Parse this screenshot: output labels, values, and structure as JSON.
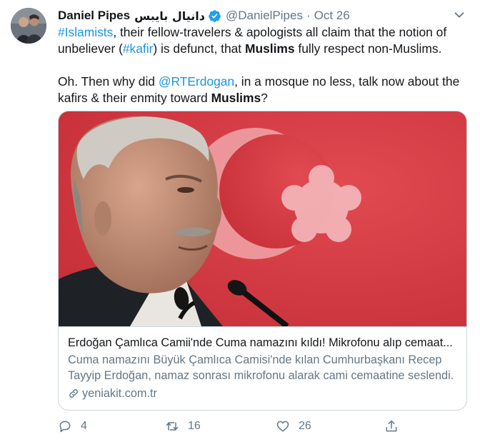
{
  "tweet": {
    "author": {
      "name": "Daniel Pipes",
      "name_arabic": "دانيال بايبس",
      "handle": "@DanielPipes",
      "separator": "·",
      "date": "Oct 26"
    },
    "text": {
      "p1": {
        "hashtag1": "#Islamists",
        "seg1": ", their fellow-travelers & apologists all claim that the notion of unbeliever (",
        "hashtag2": "#kafir",
        "seg2": ") is defunct, that ",
        "bold1": "Muslims",
        "seg3": " fully respect non-Muslims."
      },
      "p2": {
        "seg1": "Oh. Then why did ",
        "mention": "@RTErdogan",
        "seg2": ", in a mosque no less, talk now about the kafirs & their enmity toward ",
        "bold1": "Muslims",
        "seg3": "?"
      }
    },
    "card": {
      "title": "Erdoğan Çamlıca Camii'nde Cuma namazını kıldı! Mikrofonu alıp cemaat...",
      "description": "Cuma namazını Büyük Çamlıca Camisi'nde kılan Cumhurbaşkanı Recep Tayyip Erdoğan, namaz sonrası mikrofonu alarak cami cemaatine seslendi.",
      "domain": "yeniakit.com.tr"
    },
    "actions": {
      "reply_count": "4",
      "retweet_count": "16",
      "like_count": "26"
    }
  },
  "colors": {
    "link": "#1b95e0",
    "secondary": "#657786",
    "verified": "#1da1f2",
    "card_background_red": "#d93a44"
  },
  "icons": [
    "verified-badge-icon",
    "chevron-down-icon",
    "link-icon",
    "reply-icon",
    "retweet-icon",
    "like-icon",
    "share-icon"
  ]
}
